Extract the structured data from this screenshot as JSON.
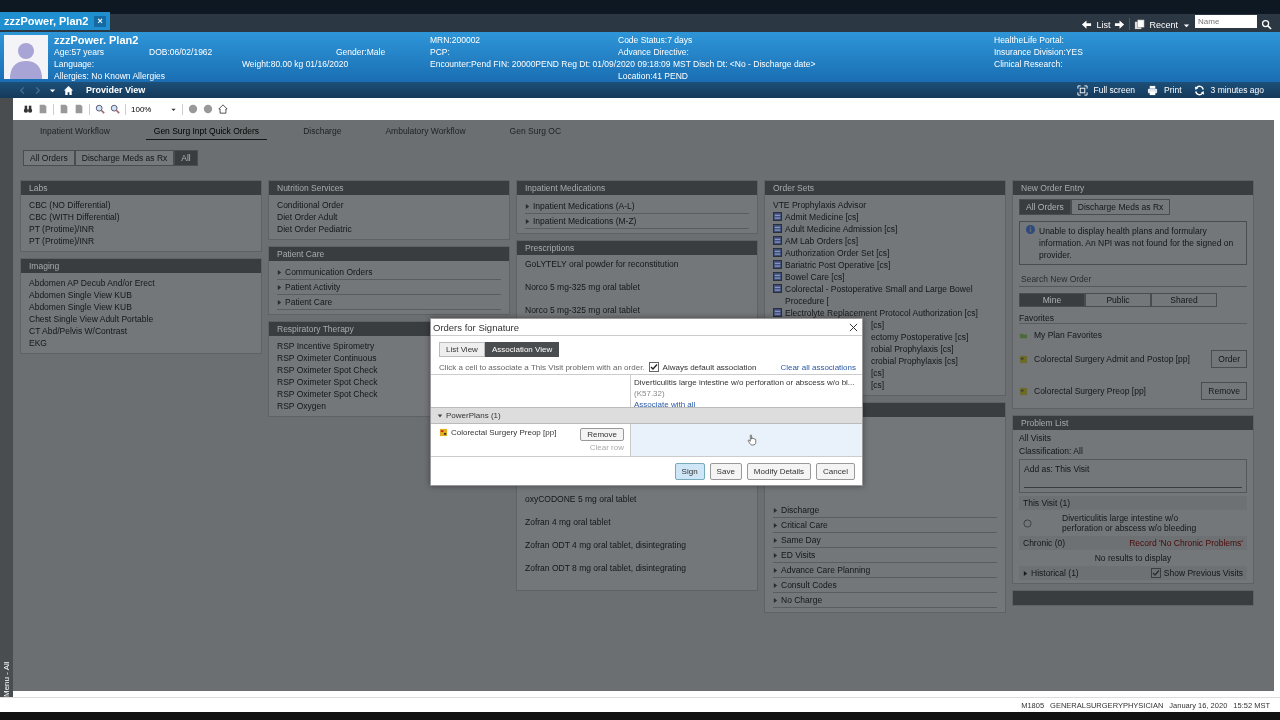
{
  "window_tab": {
    "title": "zzzPower, Plan2",
    "close": "×"
  },
  "top_nav": {
    "list": "List",
    "recent": "Recent",
    "search": {
      "placeholder": "Name"
    }
  },
  "patient": {
    "name": "zzzPower. Plan2",
    "fields": [
      "MRN:200002",
      "Code Status:7 days",
      "HealtheLife Portal:",
      "Age:57 years",
      "DOB:06/02/1962",
      "Gender:Male",
      "PCP:",
      "Advance Directive:",
      "Insurance Division:YES",
      "Language:",
      "Weight:80.00 kg 01/16/2020",
      "Encounter:Pend FIN: 20000PEND Reg Dt: 01/09/2020 09:18:09 MST  Disch Dt: <No - Discharge date>",
      "Clinical Research:",
      "Allergies: No Known Allergies",
      "Location:41 PEND"
    ]
  },
  "view_bar": {
    "title": "Provider View",
    "actions": [
      "Full screen",
      "Print",
      "3 minutes ago"
    ]
  },
  "side_menu": "Menu - All",
  "toolbar": {
    "zoom": "100%"
  },
  "workflow_tabs": [
    {
      "label": "Inpatient Workflow",
      "selected": false
    },
    {
      "label": "Gen Surg Inpt Quick Orders",
      "selected": true
    },
    {
      "label": "Discharge",
      "selected": false
    },
    {
      "label": "Ambulatory Workflow",
      "selected": false
    },
    {
      "label": "Gen Surg OC",
      "selected": false
    }
  ],
  "filters": [
    {
      "label": "All Orders",
      "selected": false
    },
    {
      "label": "Discharge Meds as Rx",
      "selected": false
    },
    {
      "label": "All",
      "selected": true
    }
  ],
  "columns": [
    {
      "panels": [
        {
          "title": "Labs",
          "items": [
            {
              "kind": "plain",
              "text": "CBC (NO Differential)"
            },
            {
              "kind": "plain",
              "text": "CBC (WITH Differential)"
            },
            {
              "kind": "plain",
              "text": "PT (Protime)/INR"
            },
            {
              "kind": "plain",
              "text": "PT (Protime)/INR"
            }
          ]
        },
        {
          "title": "Imaging",
          "items": [
            {
              "kind": "plain",
              "text": "Abdomen AP Decub And/or Erect"
            },
            {
              "kind": "plain",
              "text": "Abdomen Single View KUB"
            },
            {
              "kind": "plain",
              "text": "Abdomen Single View KUB"
            },
            {
              "kind": "plain",
              "text": "Chest Single View Adult Portable"
            },
            {
              "kind": "plain",
              "text": "CT Abd/Pelvis W/Contrast"
            },
            {
              "kind": "plain",
              "text": "EKG"
            }
          ]
        }
      ]
    },
    {
      "panels": [
        {
          "title": "Nutrition Services",
          "items": [
            {
              "kind": "plain",
              "text": "Conditional Order"
            },
            {
              "kind": "plain",
              "text": "Diet Order Adult"
            },
            {
              "kind": "plain",
              "text": "Diet Order Pediatric"
            }
          ]
        },
        {
          "title": "Patient Care",
          "items": [
            {
              "kind": "folder",
              "text": "Communication Orders"
            },
            {
              "kind": "folder",
              "text": "Patient Activity"
            },
            {
              "kind": "folder",
              "text": "Patient Care"
            }
          ]
        },
        {
          "title": "Respiratory Therapy",
          "items": [
            {
              "kind": "plain",
              "text": "RSP Incentive Spirometry"
            },
            {
              "kind": "plain",
              "text": "RSP Oximeter Continuous"
            },
            {
              "kind": "plain",
              "text": "RSP Oximeter Spot Check"
            },
            {
              "kind": "plain",
              "text": "RSP Oximeter Spot Check"
            },
            {
              "kind": "plain",
              "text": "RSP Oximeter Spot Check"
            },
            {
              "kind": "plain",
              "text": "RSP Oxygen"
            }
          ]
        }
      ]
    },
    {
      "panels": [
        {
          "title": "Inpatient Medications",
          "items": [
            {
              "kind": "folder",
              "text": "Inpatient Medications (A-L)"
            },
            {
              "kind": "folder",
              "text": "Inpatient Medications (M-Z)"
            }
          ]
        },
        {
          "title": "Prescriptions",
          "items": [
            {
              "kind": "med",
              "text": "GoLYTELY oral powder for reconstitution"
            },
            {
              "kind": "med",
              "text": "Norco 5 mg-325 mg oral tablet"
            },
            {
              "kind": "med",
              "text": "Norco 5 mg-325 mg oral tablet"
            }
          ],
          "items_below": [
            {
              "kind": "med",
              "text": "oxyCODONE 5 mg oral tablet"
            },
            {
              "kind": "med",
              "text": "Zofran 4 mg oral tablet"
            },
            {
              "kind": "med",
              "text": "Zofran ODT 4 mg oral tablet, disintegrating"
            },
            {
              "kind": "med",
              "text": "Zofran ODT 8 mg oral tablet, disintegrating"
            }
          ]
        }
      ]
    },
    {
      "panels": [
        {
          "title": "Order Sets",
          "items": [
            {
              "kind": "plain",
              "text": "VTE Prophylaxis Advisor"
            },
            {
              "kind": "orderset",
              "text": "Admit Medicine [cs]"
            },
            {
              "kind": "orderset",
              "text": "Adult Medicine Admission [cs]"
            },
            {
              "kind": "orderset",
              "text": "AM Lab Orders [cs]"
            },
            {
              "kind": "orderset",
              "text": "Authorization Order Set [cs]"
            },
            {
              "kind": "orderset",
              "text": "Bariatric Post Operative [cs]"
            },
            {
              "kind": "orderset",
              "text": "Bowel Care [cs]"
            },
            {
              "kind": "orderset",
              "text": "Colorectal - Postoperative Small and Large Bowel Procedure ["
            },
            {
              "kind": "orderset",
              "text": "Electrolyte Replacement Protocol Authorization [cs]"
            },
            {
              "kind": "partial",
              "text": "[cs]"
            },
            {
              "kind": "partial",
              "text": "ectomy Postoperative [cs]"
            },
            {
              "kind": "partial",
              "text": "robial Prophylaxis [cs]"
            },
            {
              "kind": "partial",
              "text": "crobial Prophylaxis [cs]"
            },
            {
              "kind": "partial",
              "text": "[cs]"
            },
            {
              "kind": "partial",
              "text": "[cs]"
            }
          ]
        },
        {
          "items_below": [
            {
              "kind": "folder",
              "text": "Discharge"
            },
            {
              "kind": "folder",
              "text": "Critical Care"
            },
            {
              "kind": "folder",
              "text": "Same Day"
            },
            {
              "kind": "folder",
              "text": "ED Visits"
            },
            {
              "kind": "folder",
              "text": "Advance Care Planning"
            },
            {
              "kind": "folder",
              "text": "Consult Codes"
            },
            {
              "kind": "folder",
              "text": "No Charge"
            }
          ]
        }
      ]
    }
  ],
  "order_entry": {
    "title": "New Order Entry",
    "tabs": [
      {
        "label": "All Orders",
        "selected": true
      },
      {
        "label": "Discharge Meds as Rx",
        "selected": false
      }
    ],
    "notice": "Unable to display health plans and formulary information. An NPI was not found for the signed on provider.",
    "search": {
      "placeholder": "Search New Order"
    },
    "scopes": [
      {
        "label": "Mine",
        "selected": true
      },
      {
        "label": "Public",
        "selected": false
      },
      {
        "label": "Shared",
        "selected": false
      }
    ],
    "favorites_label": "Favorites",
    "folder": "My Plan Favorites",
    "plans": [
      {
        "name": "Colorectal Surgery Admit and Postop [pp]",
        "action": "Order"
      },
      {
        "name": "Colorectal Surgery Preop [pp]",
        "action": "Remove"
      }
    ]
  },
  "problem_list": {
    "title": "Problem List",
    "visits": "All Visits",
    "classification": "Classification: All",
    "add_as": "Add as: This Visit",
    "this_visit": "This Visit (1)",
    "problem": "Diverticulitis large intestine w/o perforation or abscess w/o bleeding",
    "chronic": "Chronic (0)",
    "record": "Record 'No Chronic Problems'",
    "empty": "No results to display",
    "historical": "Historical (1)",
    "previous": {
      "label": "Show Previous Visits",
      "checked": true
    }
  },
  "dialog": {
    "title": "Orders for Signature",
    "views": [
      {
        "label": "List View",
        "selected": false
      },
      {
        "label": "Association View",
        "selected": true
      }
    ],
    "hint": "Click a cell to associate a This Visit problem with an order.",
    "default_assoc": {
      "label": "Always default association",
      "checked": true
    },
    "clear_all": "Clear all associations",
    "problem": {
      "name": "Diverticulitis large intestine w/o perforation or abscess w/o bl...",
      "code": "(K57.32)",
      "link": "Associate with all"
    },
    "group": {
      "label": "PowerPlans (1)",
      "expanded": true
    },
    "order": {
      "name": "Colorectal Surgery Preop [pp]",
      "remove": "Remove",
      "clear": "Clear row"
    },
    "buttons": [
      {
        "label": "Sign",
        "selected": true
      },
      {
        "label": "Save",
        "selected": false
      },
      {
        "label": "Modify Details",
        "selected": false
      },
      {
        "label": "Cancel",
        "selected": false
      }
    ]
  },
  "status_bar": [
    "M1805",
    "GENERALSURGERYPHYSICIAN",
    "January 16, 2020",
    "15:52 MST"
  ]
}
